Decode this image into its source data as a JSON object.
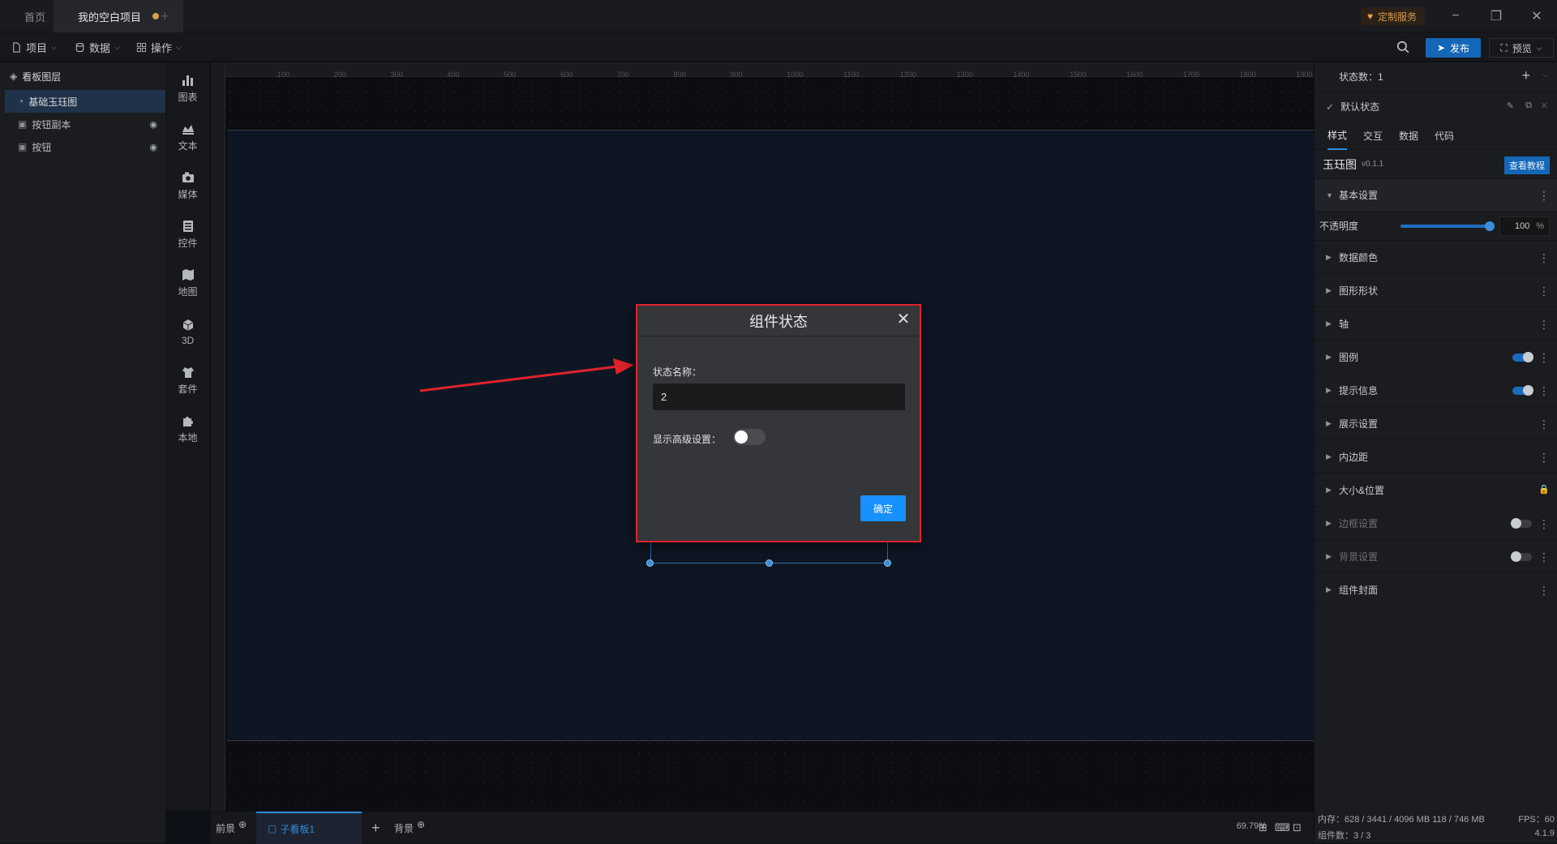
{
  "titlebar": {
    "tabs": [
      {
        "label": "首页"
      },
      {
        "label": "我的空白项目"
      }
    ],
    "new_tab": "+",
    "custom_service": "定制服务",
    "minimize": "−",
    "restore": "❐",
    "close": "✕"
  },
  "menubar": {
    "project": "项目",
    "data": "数据",
    "operation": "操作",
    "publish": "发布",
    "preview": "预览"
  },
  "layers": {
    "title": "看板图层",
    "items": [
      {
        "label": "基础玉珏图",
        "selected": true
      },
      {
        "label": "按钮副本"
      },
      {
        "label": "按钮"
      }
    ]
  },
  "tools": [
    {
      "label": "图表",
      "icon": "chart-icon"
    },
    {
      "label": "文本",
      "icon": "text-icon"
    },
    {
      "label": "媒体",
      "icon": "media-icon"
    },
    {
      "label": "控件",
      "icon": "widget-icon"
    },
    {
      "label": "地图",
      "icon": "map-icon"
    },
    {
      "label": "3D",
      "icon": "cube-icon"
    },
    {
      "label": "套件",
      "icon": "kit-icon"
    },
    {
      "label": "本地",
      "icon": "puzzle-icon"
    }
  ],
  "ruler": {
    "h_ticks": [
      "100",
      "200",
      "300",
      "400",
      "500",
      "600",
      "700",
      "800",
      "900",
      "1000",
      "1100",
      "1200",
      "1300",
      "1400",
      "1500",
      "1600",
      "1700",
      "1800",
      "1900"
    ]
  },
  "bottombar": {
    "foreground": "前景",
    "sub_board": "子看板1",
    "add": "+",
    "background": "背景",
    "zoom": "69.79%"
  },
  "rpanel": {
    "state_count": "状态数：1",
    "default_state": "默认状态",
    "tabs": [
      "样式",
      "交互",
      "数据",
      "代码"
    ],
    "component_name": "玉珏图",
    "version": "v0.1.1",
    "tutorial": "查看教程",
    "basic_settings": "基本设置",
    "opacity_label": "不透明度",
    "opacity_value": "100",
    "opacity_unit": "%",
    "opacity_fraction": 1.0,
    "sections": [
      {
        "label": "数据颜色"
      },
      {
        "label": "图形形状"
      },
      {
        "label": "轴"
      },
      {
        "label": "图例"
      },
      {
        "label": "提示信息"
      },
      {
        "label": "展示设置"
      },
      {
        "label": "内边距"
      },
      {
        "label": "大小&位置"
      },
      {
        "label": "边框设置"
      },
      {
        "label": "背景设置"
      },
      {
        "label": "组件封面"
      }
    ],
    "memory": "内存：628 / 3441 / 4096 MB  118 / 746 MB",
    "fps": "FPS：60",
    "component_count": "组件数：3 / 3",
    "app_version": "4.1.9"
  },
  "dialog": {
    "title": "组件状态",
    "name_label": "状态名称：",
    "name_value": "2",
    "advanced_label": "显示高级设置：",
    "confirm": "确定"
  }
}
